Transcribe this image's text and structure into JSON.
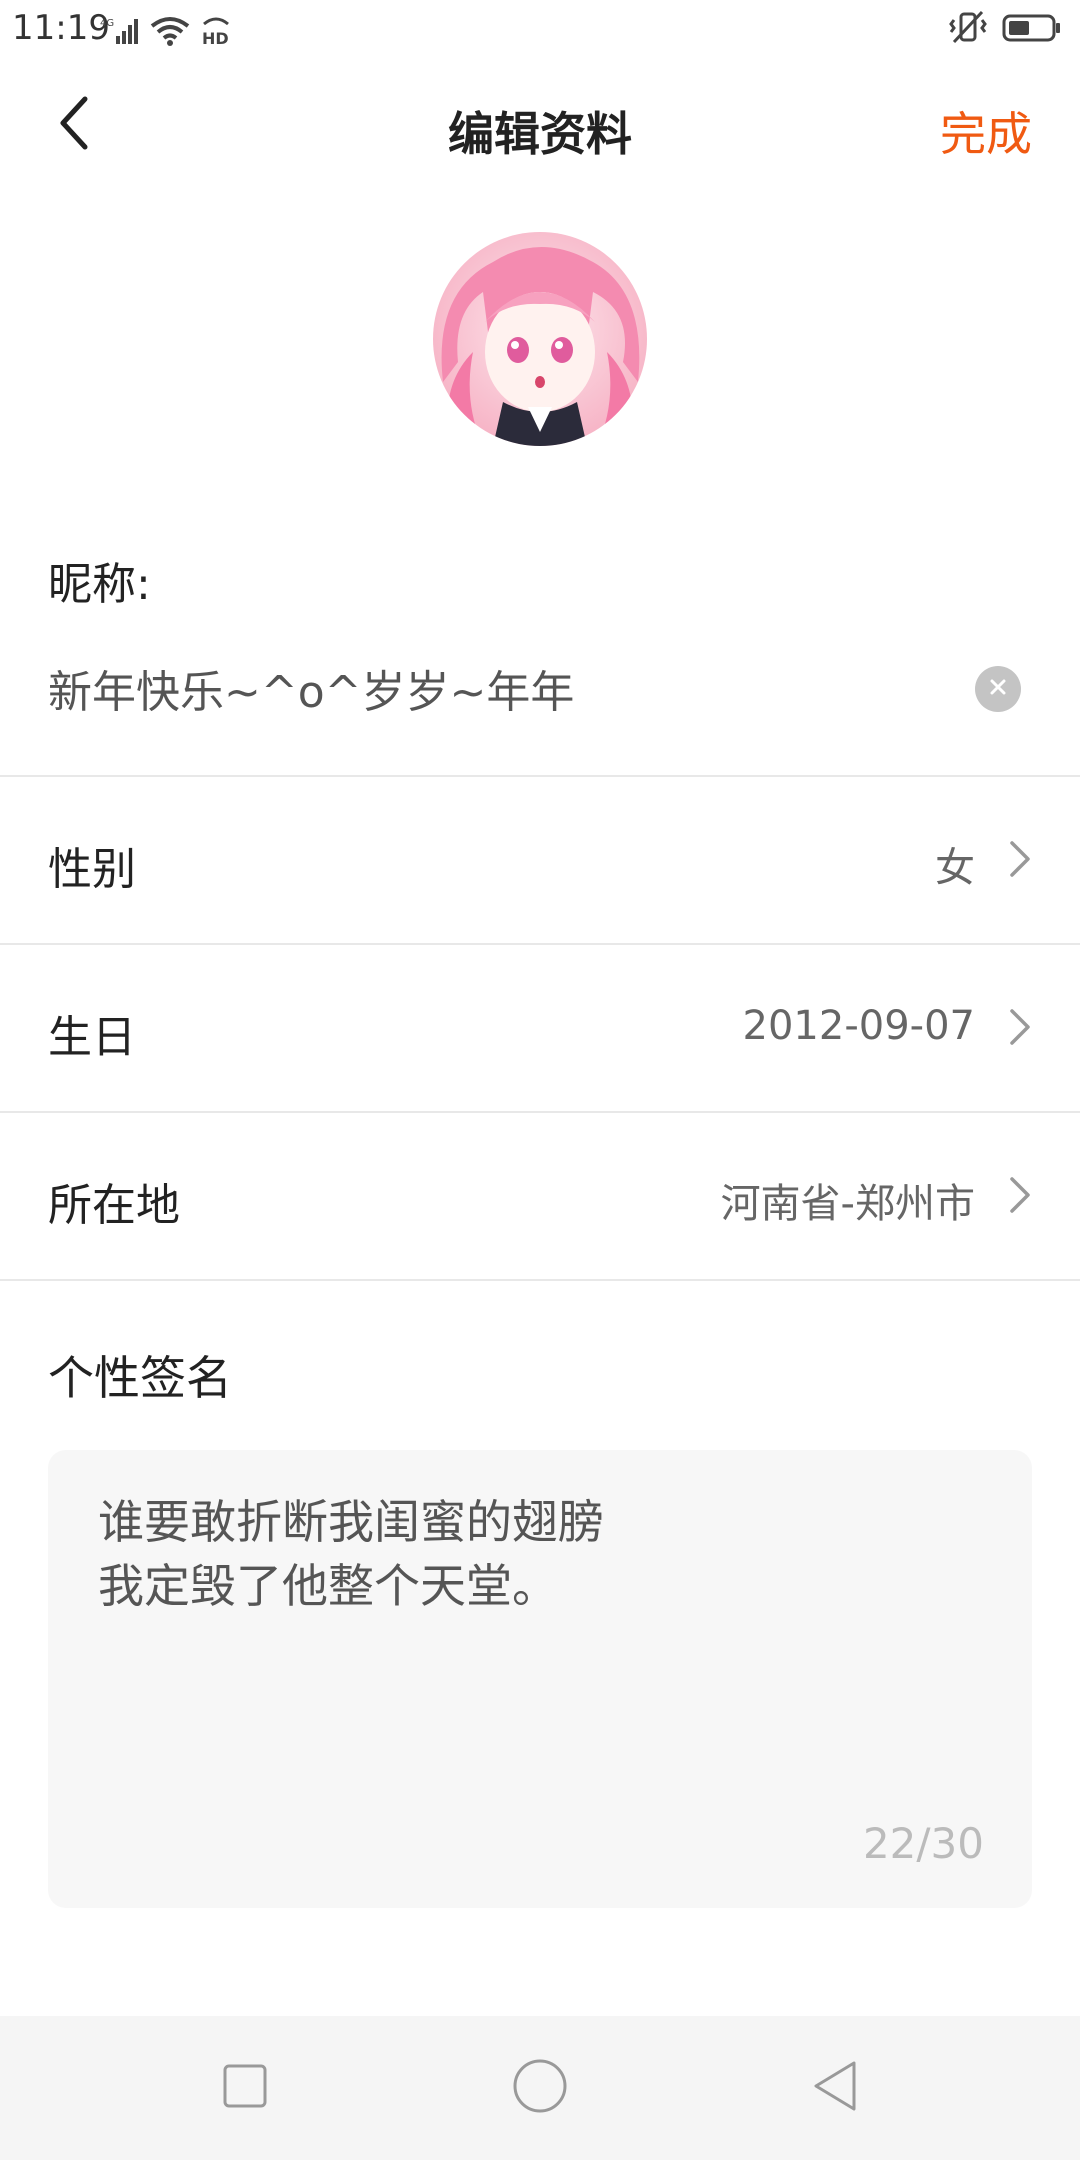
{
  "status_bar": {
    "time": "11:19",
    "icons": [
      "4g-signal-icon",
      "wifi-icon",
      "hd-icon",
      "vibrate-icon",
      "battery-icon"
    ]
  },
  "header": {
    "title": "编辑资料",
    "done_label": "完成",
    "accent_color": "#f05a12"
  },
  "profile": {
    "nickname_label": "昵称:",
    "nickname_value": "新年快乐~^o^岁岁~年年",
    "gender": {
      "label": "性别",
      "value": "女"
    },
    "birthday": {
      "label": "生日",
      "value": "2012-09-07"
    },
    "location": {
      "label": "所在地",
      "value": "河南省-郑州市"
    },
    "signature": {
      "label": "个性签名",
      "value": "谁要敢折断我闺蜜的翅膀\n我定毁了他整个天堂。",
      "counter": "22/30"
    }
  },
  "nav_bar": {
    "buttons": [
      "recents-icon",
      "home-icon",
      "back-icon"
    ]
  }
}
